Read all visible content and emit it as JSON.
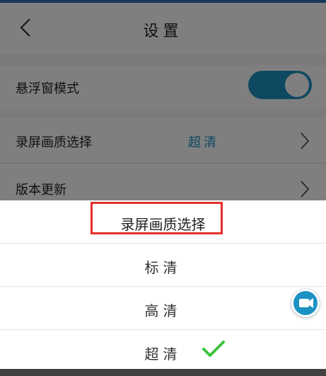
{
  "header": {
    "title": "设置"
  },
  "settings": {
    "floating_window_label": "悬浮窗模式",
    "floating_window_enabled": true,
    "quality_label": "录屏画质选择",
    "quality_value": "超清",
    "update_label": "版本更新"
  },
  "sheet": {
    "title": "录屏画质选择",
    "options": [
      {
        "label": "标清",
        "selected": false
      },
      {
        "label": "高清",
        "selected": false
      },
      {
        "label": "超清",
        "selected": true
      }
    ]
  },
  "colors": {
    "accent": "#1c92c3",
    "highlight": "#e5302a",
    "check": "#3cc53c"
  },
  "icons": {
    "back": "chevron-left-icon",
    "row_arrow": "chevron-right-icon",
    "selected": "checkmark-icon",
    "floating": "video-camera-icon"
  }
}
